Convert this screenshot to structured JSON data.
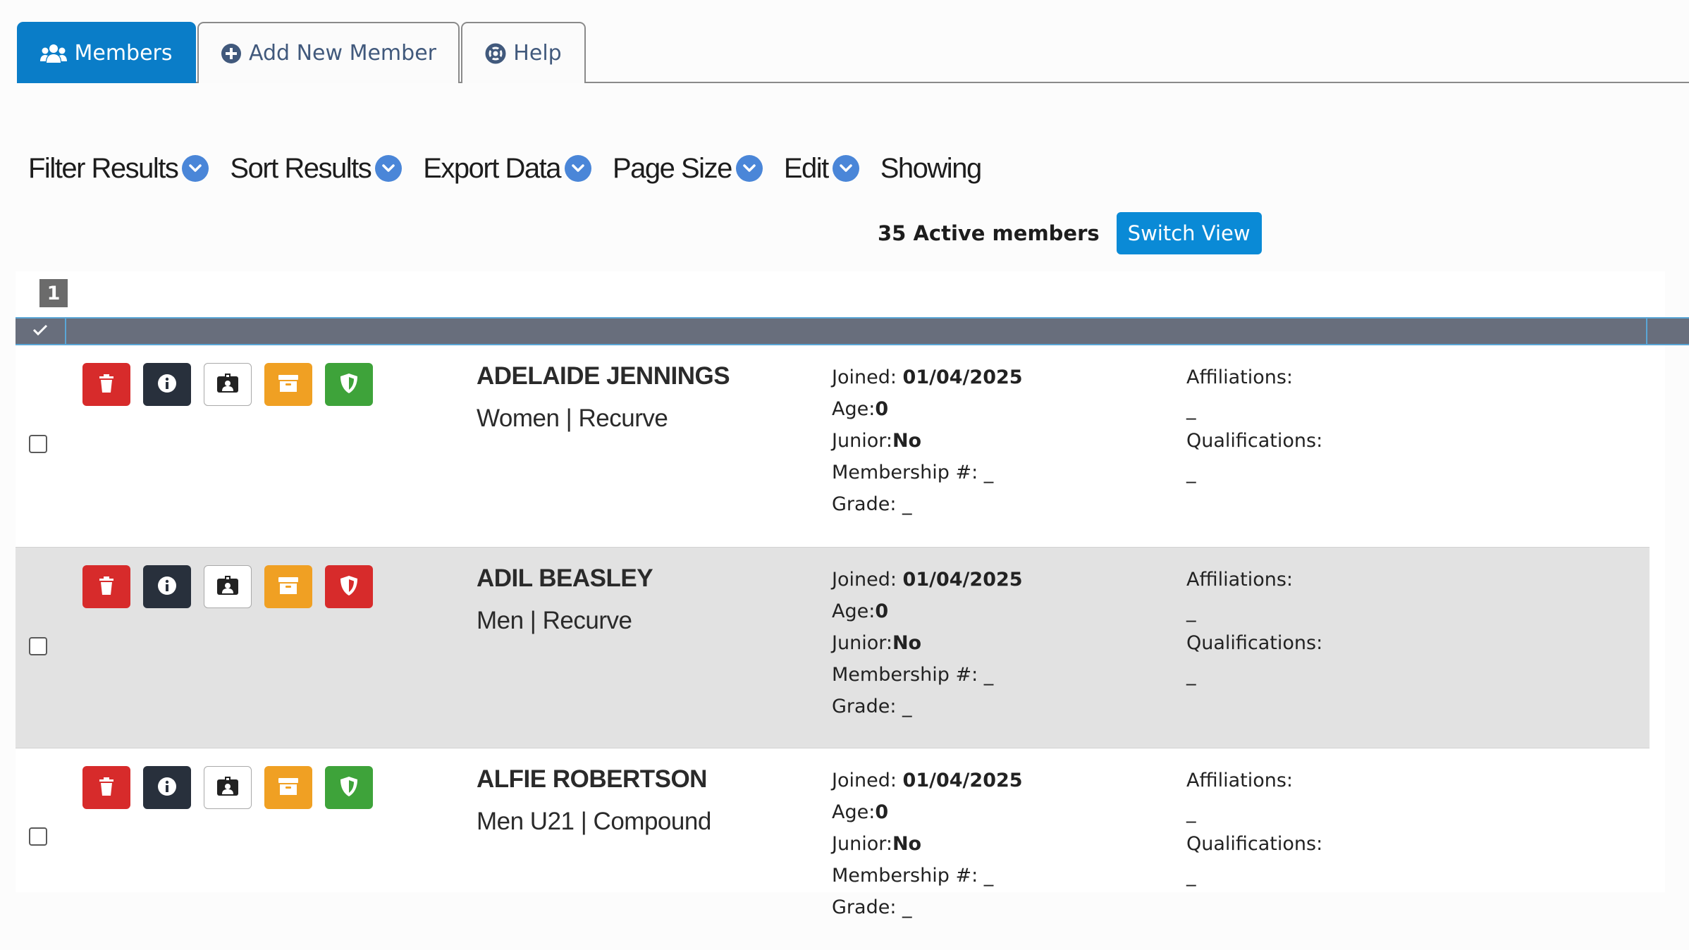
{
  "tabs": [
    {
      "label": "Members",
      "icon": "users-icon",
      "active": true
    },
    {
      "label": "Add New Member",
      "icon": "plus-circle-icon",
      "active": false
    },
    {
      "label": "Help",
      "icon": "lifebuoy-icon",
      "active": false
    }
  ],
  "toolbar": {
    "filter": "Filter Results",
    "sort": "Sort Results",
    "export": "Export Data",
    "page_size": "Page Size",
    "edit": "Edit",
    "showing": "Showing"
  },
  "summary": {
    "active_count": "35 Active members",
    "switch_view": "Switch View"
  },
  "pagination": {
    "current_page": "1"
  },
  "labels": {
    "joined": "Joined:",
    "age": "Age:",
    "junior": "Junior:",
    "membership": "Membership #:",
    "grade": "Grade:",
    "affiliations": "Affiliations:",
    "qualifications": "Qualifications:",
    "empty": "_"
  },
  "members": [
    {
      "name": "ADELAIDE JENNINGS",
      "division": "Women | Recurve",
      "joined": "01/04/2025",
      "age": "0",
      "junior": "No",
      "membership": "_",
      "grade": "_",
      "affiliations": "_",
      "qualifications": "_",
      "status_color": "green"
    },
    {
      "name": "ADIL BEASLEY",
      "division": "Men | Recurve",
      "joined": "01/04/2025",
      "age": "0",
      "junior": "No",
      "membership": "_",
      "grade": "_",
      "affiliations": "_",
      "qualifications": "_",
      "status_color": "red"
    },
    {
      "name": "ALFIE ROBERTSON",
      "division": "Men U21 | Compound",
      "joined": "01/04/2025",
      "age": "0",
      "junior": "No",
      "membership": "_",
      "grade": "_",
      "affiliations": "_",
      "qualifications": "_",
      "status_color": "green"
    }
  ],
  "colors": {
    "primary": "#0a7dc8",
    "delete": "#d72b2b",
    "info": "#28303c",
    "archive": "#f0a023",
    "status_ok": "#3ea33a",
    "status_bad": "#d72b2b",
    "header_bar": "#686e7c"
  }
}
